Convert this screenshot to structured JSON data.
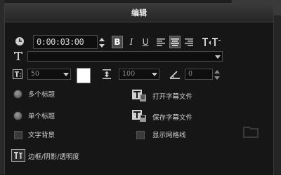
{
  "panel": {
    "title": "编辑"
  },
  "toolbar": {
    "timecode": "0:00:03:00",
    "bold_label": "B",
    "italic_label": "I",
    "underline_label": "U"
  },
  "font": {
    "value": ""
  },
  "size": {
    "value": "50"
  },
  "line_spacing": {
    "value": "100"
  },
  "rotation": {
    "value": "0"
  },
  "options": {
    "multi_title": "多个标题",
    "single_title": "单个标题",
    "text_background": "文字背景",
    "open_subtitle": "打开字幕文件",
    "save_subtitle": "保存字幕文件",
    "show_grid": "显示网格线",
    "border_shadow": "边框/阴影/透明度"
  },
  "colors": {
    "text_color": "#ffffff"
  },
  "icons": [
    "clock-icon",
    "spin-arrows-icon",
    "align-left-icon",
    "align-center-icon",
    "align-right-icon",
    "text-direction-icon",
    "font-icon",
    "font-size-icon",
    "line-spacing-icon",
    "rotation-icon",
    "open-subtitle-icon",
    "save-subtitle-icon",
    "border-shadow-icon"
  ]
}
